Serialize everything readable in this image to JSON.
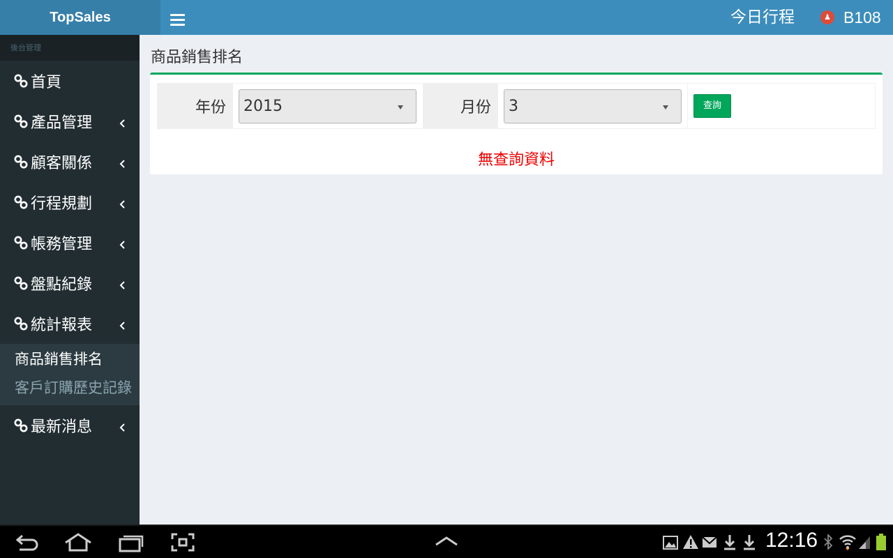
{
  "app": {
    "brand": "TopSales"
  },
  "header": {
    "schedule_label": "今日行程",
    "user_name": "B108",
    "user_avatar_glyph": "♟"
  },
  "sidebar": {
    "section_header": "後台管理",
    "items": [
      {
        "label": "首頁",
        "has_children": false
      },
      {
        "label": "產品管理",
        "has_children": true
      },
      {
        "label": "顧客關係",
        "has_children": true
      },
      {
        "label": "行程規劃",
        "has_children": true
      },
      {
        "label": "帳務管理",
        "has_children": true
      },
      {
        "label": "盤點紀錄",
        "has_children": true
      },
      {
        "label": "統計報表",
        "has_children": true,
        "expanded": true
      },
      {
        "label": "最新消息",
        "has_children": true
      }
    ],
    "submenu": [
      {
        "label": "商品銷售排名",
        "active": true
      },
      {
        "label": "客戶訂購歷史記錄",
        "active": false
      }
    ]
  },
  "page": {
    "title": "商品銷售排名",
    "filters": {
      "year_label": "年份",
      "year_value": "2015",
      "month_label": "月份",
      "month_value": "3",
      "query_button": "查詢"
    },
    "empty_message": "無查詢資料"
  },
  "system_bar": {
    "time": "12:16"
  },
  "colors": {
    "header": "#3c8dbc",
    "logo_bg": "#367fa9",
    "sidebar": "#222d32",
    "accent_green": "#00a65a",
    "empty_text": "#ee0000"
  }
}
